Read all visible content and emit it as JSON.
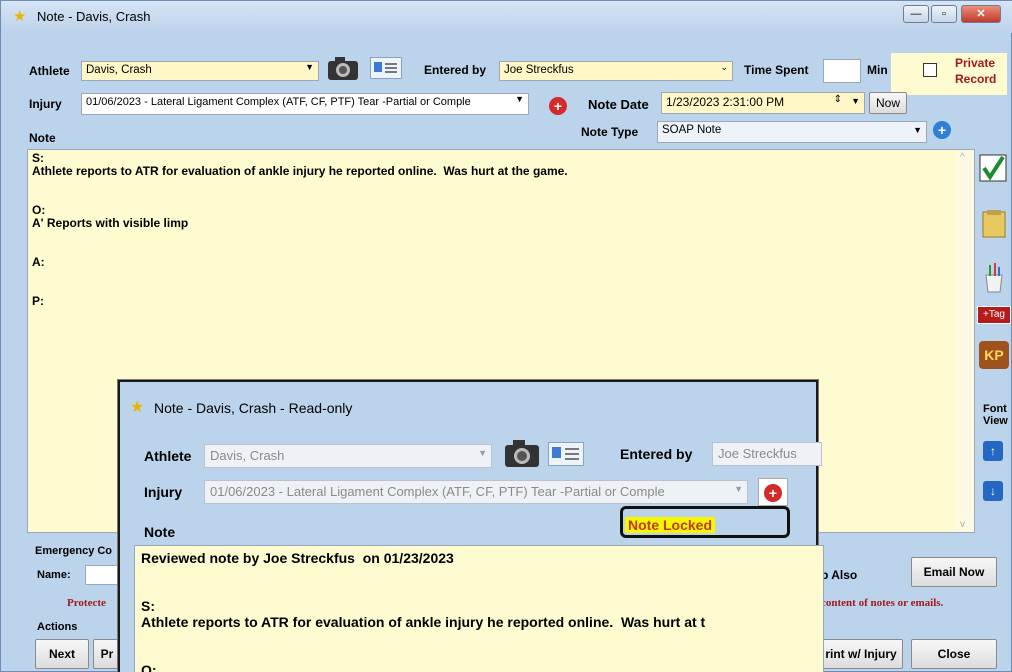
{
  "window": {
    "title": "Note - Davis, Crash"
  },
  "athlete": {
    "label": "Athlete",
    "value": "Davis, Crash"
  },
  "entered_by": {
    "label": "Entered by",
    "value": "Joe Streckfus"
  },
  "time_spent": {
    "label": "Time Spent",
    "value": "",
    "unit": "Min"
  },
  "private_record": {
    "label_line1": "Private",
    "label_line2": "Record"
  },
  "injury": {
    "label": "Injury",
    "value": "01/06/2023 - Lateral Ligament Complex (ATF, CF, PTF) Tear -Partial or Comple"
  },
  "note_date": {
    "label": "Note Date",
    "value": "1/23/2023  2:31:00 PM",
    "now_label": "Now"
  },
  "note_label": "Note",
  "note_type": {
    "label": "Note Type",
    "value": "SOAP Note"
  },
  "note_lines": [
    "S:",
    "Athlete reports to ATR for evaluation of ankle injury he reported online.  Was hurt at the game.",
    "",
    "",
    "O:",
    "A' Reports with visible limp",
    "",
    "",
    "A:",
    "",
    "",
    "P:"
  ],
  "sidebar": {
    "tag_label": "+Tag",
    "kp_label": "KP",
    "font_label": "Font",
    "view_label": "View"
  },
  "bottom": {
    "emergency_label": "Emergency Co",
    "name_label": "Name:",
    "protected_text": "Protecte",
    "protected_text_right": "content of notes or emails.",
    "sup_also": "p Also",
    "email_now": "Email Now",
    "actions_label": "Actions",
    "next": "Next",
    "prev": "Pr",
    "print_injury": "rint w/ Injury",
    "close": "Close"
  },
  "dialog": {
    "title": "Note - Davis, Crash  - Read-only",
    "athlete_label": "Athlete",
    "athlete_value": "Davis, Crash",
    "entered_by_label": "Entered by",
    "entered_by_value": "Joe Streckfus",
    "injury_label": "Injury",
    "injury_value": "01/06/2023 - Lateral Ligament Complex (ATF, CF, PTF) Tear -Partial or Comple",
    "note_label": "Note",
    "locked_label": "Note Locked",
    "note_lines": [
      "Reviewed note by Joe Streckfus  on 01/23/2023",
      "",
      "",
      "S:",
      "Athlete reports to ATR for evaluation of ankle injury he reported online.  Was hurt at t",
      "",
      "",
      "O:"
    ]
  }
}
